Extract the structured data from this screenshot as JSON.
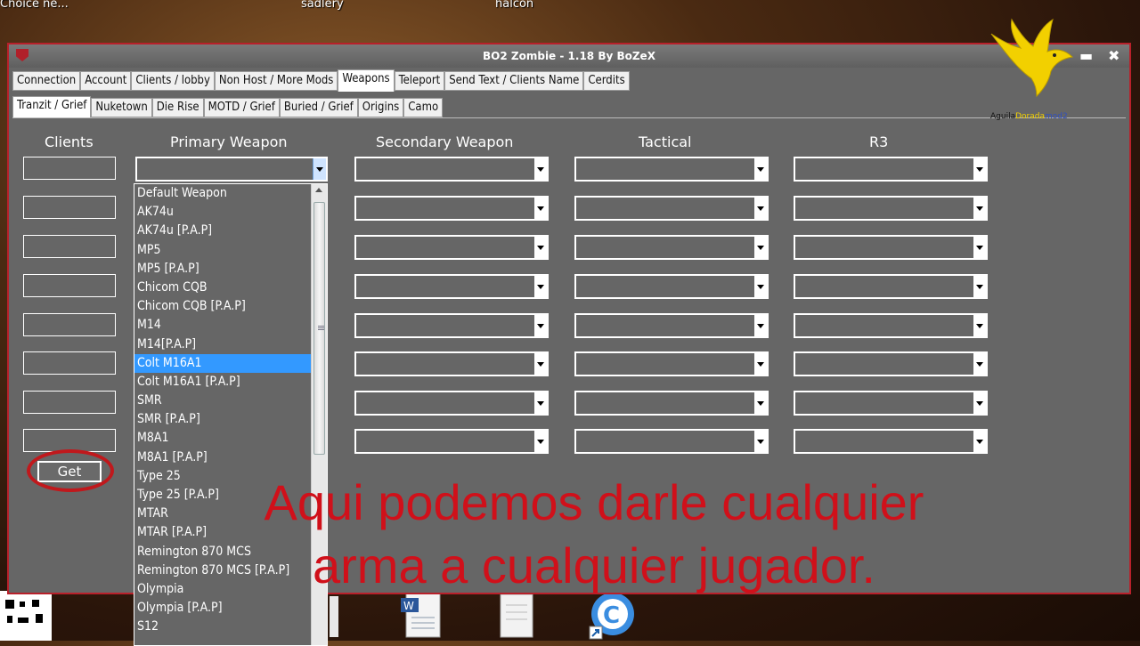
{
  "desktop": {
    "labels": [
      "Choice ne...",
      "sadlery",
      "halcon"
    ]
  },
  "window": {
    "title": "BO2 Zombie - 1.18 By BoZeX",
    "minimize": "▬",
    "close": "✖"
  },
  "logo": {
    "word1": "Aguila",
    "word2": "Dorada",
    "word3": "mod2"
  },
  "tabs": [
    "Connection",
    "Account",
    "Clients / lobby",
    "Non Host / More Mods",
    "Weapons",
    "Teleport",
    "Send Text  / Clients Name",
    "Cerdits"
  ],
  "active_tab": "Weapons",
  "subtabs": [
    "Tranzit / Grief",
    "Nuketown",
    "Die Rise",
    "MOTD / Grief",
    "Buried / Grief",
    "Origins",
    "Camo"
  ],
  "active_subtab": "Tranzit / Grief",
  "columns": {
    "clients": "Clients",
    "primary": "Primary Weapon",
    "secondary": "Secondary Weapon",
    "tactical": "Tactical",
    "r3": "R3"
  },
  "get_button": "Get",
  "dropdown": {
    "items": [
      "Default Weapon",
      "AK74u",
      "AK74u [P.A.P]",
      "MP5",
      "MP5 [P.A.P]",
      "Chicom CQB",
      "Chicom CQB [P.A.P]",
      "M14",
      "M14[P.A.P]",
      "Colt M16A1",
      "Colt M16A1 [P.A.P]",
      "SMR",
      "SMR [P.A.P]",
      "M8A1",
      "M8A1 [P.A.P]",
      "Type 25",
      "Type 25 [P.A.P]",
      "MTAR",
      "MTAR [P.A.P]",
      "Remington 870 MCS",
      "Remington 870 MCS [P.A.P]",
      "Olympia",
      "Olympia [P.A.P]",
      "S12"
    ],
    "selected": "Colt M16A1"
  },
  "subtitle": {
    "line1": "Aqui podemos darle cualquier",
    "line2": "arma a cualquier jugador."
  },
  "colors": {
    "accent": "#b8202a",
    "selection": "#3399ff",
    "subtitle": "#d0101a",
    "panel": "#666666"
  }
}
